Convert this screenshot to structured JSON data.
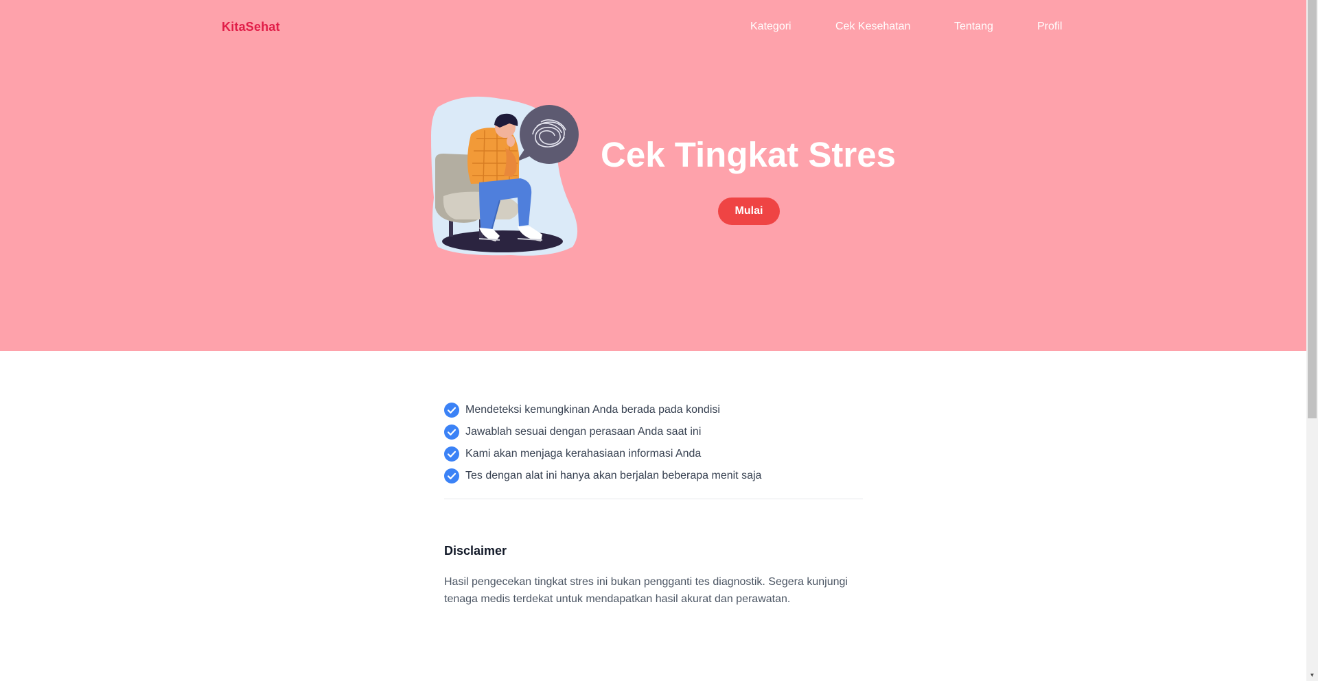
{
  "nav": {
    "brand": "KitaSehat",
    "links": [
      "Kategori",
      "Cek Kesehatan",
      "Tentang",
      "Profil"
    ]
  },
  "hero": {
    "title": "Cek Tingkat Stres",
    "button_label": "Mulai",
    "illustration": "stressed-person-illustration"
  },
  "checklist": [
    "Mendeteksi kemungkinan Anda berada pada kondisi",
    "Jawablah sesuai dengan perasaan Anda saat ini",
    "Kami akan menjaga kerahasiaan informasi Anda",
    "Tes dengan alat ini hanya akan berjalan beberapa menit saja"
  ],
  "disclaimer": {
    "title": "Disclaimer",
    "body": "Hasil pengecekan tingkat stres ini bukan pengganti tes diagnostik. Segera kunjungi tenaga medis terdekat untuk mendapatkan hasil akurat dan perawatan."
  },
  "icons": {
    "check": "check-circle-icon",
    "scroll_down": "scroll-down-arrow-icon"
  },
  "colors": {
    "hero_bg": "#fea2ab",
    "brand": "#e11d48",
    "button": "#ef4444",
    "check": "#3b82f6"
  }
}
